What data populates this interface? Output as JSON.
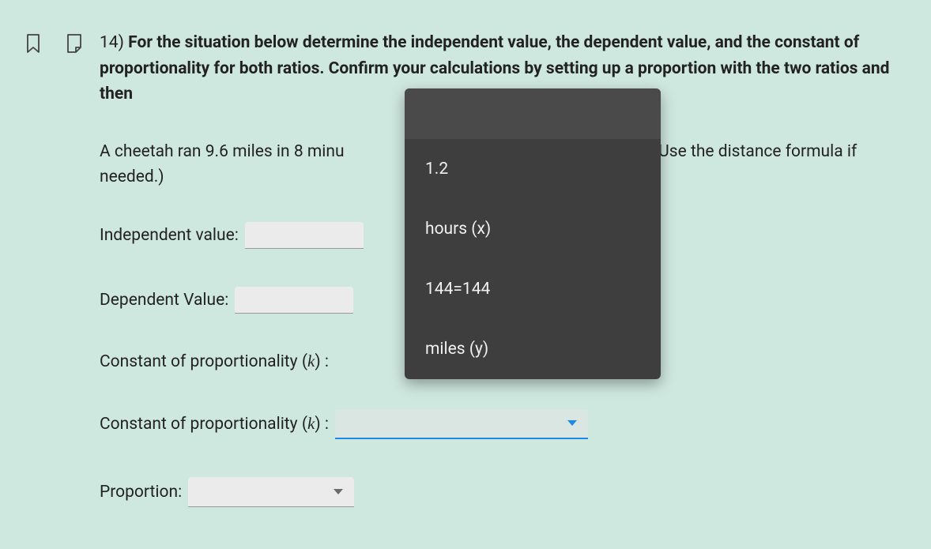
{
  "question": {
    "number": "14)",
    "prompt_bold": "For the situation below determine the independent value, the dependent value, and the constant of proportionality for both ratios. Confirm your calculations by setting up a propor­tion with the two ratios and then",
    "body_pre": "A cheetah ran 9.6 miles in 8 minu",
    "body_post": "s. (Hint: Use the distance for­mula if needed.)"
  },
  "labels": {
    "independent": "Independent value:",
    "dependent": "Dependent Value:",
    "k1_pre": "Constant of proportionality (",
    "k1_var": "k",
    "k1_post": ") :",
    "k2_pre": "Constant of proportionality (",
    "k2_var": "k",
    "k2_post": ") :",
    "proportion": "Proportion:"
  },
  "dropdown": {
    "options": [
      "1.2",
      "hours (x)",
      "144=144",
      "miles (y)"
    ]
  }
}
